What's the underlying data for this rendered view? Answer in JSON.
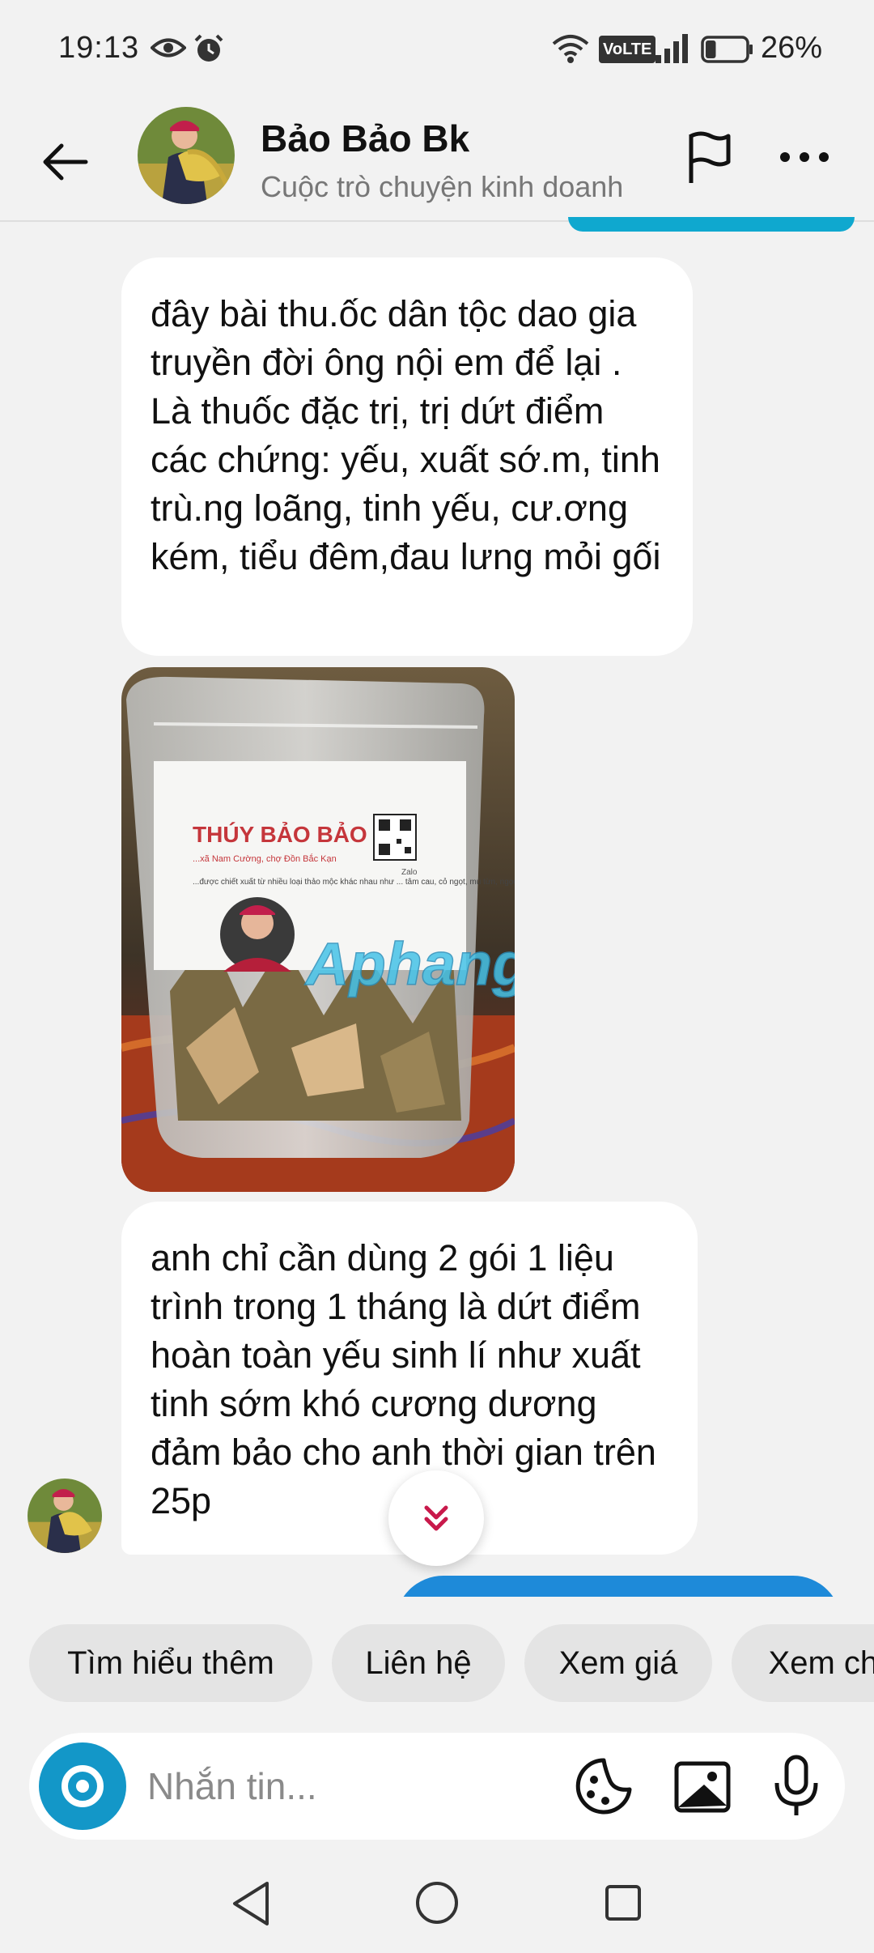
{
  "status_bar": {
    "time": "19:13",
    "network_badge": "VoLTE",
    "battery_percent": "26%",
    "battery_level": 0.26
  },
  "header": {
    "contact_name": "Bảo Bảo Bk",
    "subtitle": "Cuộc trò chuyện kinh doanh"
  },
  "messages": [
    {
      "direction": "incoming",
      "type": "text",
      "text": "đây bài thu.ốc dân tộc dao gia truyền đời ông nội em để lại . Là thuốc đặc trị, trị dứt điểm các chứng: yếu, xuất sớ.m, tinh trù.ng loãng, tinh yếu, cư.ơng kém, tiểu đêm,đau lưng mỏi gối"
    },
    {
      "direction": "incoming",
      "type": "image",
      "label_title": "THÚY BẢO BẢO",
      "label_address": "...xã Nam Cường, chợ Đồn Bắc Kạn",
      "label_body": "...được chiết xuất từ nhiều loại thảo mộc khác nhau như ... tâm cau, cỏ ngọt, mú từn, ngọc cẩu, bá bệnh, cốt toái bổ ...",
      "label_qr_caption": "Zalo",
      "watermark": "Aphang"
    },
    {
      "direction": "incoming",
      "type": "text",
      "text": "anh chỉ cần dùng 2 gói 1 liệu trình trong 1 tháng là dứt điểm hoàn toàn yếu sinh lí như xuất tinh sớm khó cương dương đảm bảo cho anh thời gian trên 25p"
    }
  ],
  "quick_replies": [
    "Tìm hiểu thêm",
    "Liên hệ",
    "Xem giá",
    "Xem chi tiết"
  ],
  "composer": {
    "placeholder": "Nhắn tin..."
  },
  "colors": {
    "accent": "#1397c8",
    "outgoing_bubble": "#1e8ad9",
    "background": "#f2f2f2",
    "incoming_bubble": "#ffffff"
  },
  "icons": [
    "eye-icon",
    "alarm-icon",
    "wifi-icon",
    "signal-icon",
    "battery-icon",
    "back-arrow-icon",
    "flag-icon",
    "more-icon",
    "chevron-double-down-icon",
    "camera-icon",
    "sticker-icon",
    "gallery-icon",
    "mic-icon",
    "nav-back-icon",
    "nav-home-icon",
    "nav-recent-icon"
  ]
}
